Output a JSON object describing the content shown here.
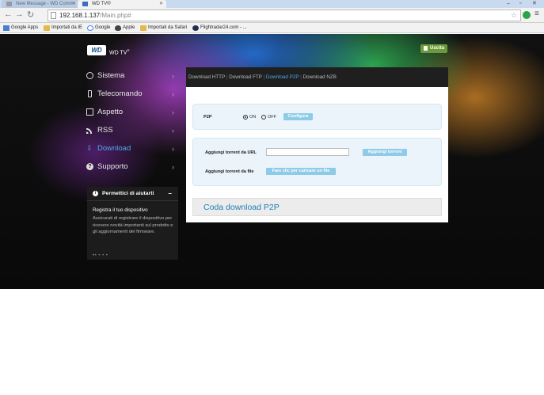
{
  "browser": {
    "tabs": [
      {
        "title": "New Message - WD Comm",
        "active": false
      },
      {
        "title": "WD TV®",
        "active": true
      }
    ],
    "url_host": "192.168.1.137",
    "url_path": "/Main.php#",
    "bookmarks": [
      "Google Apps",
      "Importati da IE",
      "Google",
      "Apple",
      "Importati da Safari",
      "Flightradar24.com - ..."
    ]
  },
  "header": {
    "logo": "WD",
    "product": "WD TV",
    "logout": "Uscita"
  },
  "sidebar": {
    "items": [
      {
        "label": "Sistema",
        "icon": "gear-icon",
        "active": false
      },
      {
        "label": "Telecomando",
        "icon": "remote-icon",
        "active": false
      },
      {
        "label": "Aspetto",
        "icon": "picture-icon",
        "active": false
      },
      {
        "label": "RSS",
        "icon": "rss-icon",
        "active": false
      },
      {
        "label": "Download",
        "icon": "download-icon",
        "active": true
      },
      {
        "label": "Supporto",
        "icon": "help-icon",
        "active": false
      }
    ]
  },
  "help": {
    "title": "Permettici di aiutarti",
    "subtitle": "Registra il tuo dispositivo",
    "text": "Assicurati di registrare il dispositivo per ricevere novità importanti sul prodotto e gli aggiornamenti del firmware."
  },
  "panel": {
    "tabs": [
      "Download HTTP",
      "Download FTP",
      "Download P2P",
      "Download NZB"
    ],
    "selected_tab": "Download P2P",
    "p2p": {
      "label": "P2P",
      "on_label": "ON",
      "off_label": "OFF",
      "state": "ON",
      "config_button": "Configura"
    },
    "torrent": {
      "url_label": "Aggiungi torrent da URL",
      "url_value": "",
      "add_button": "Aggiungi torrent",
      "file_label": "Aggiungi torrent da file",
      "file_button": "Fare clic per caricare un file"
    },
    "queue_title": "Coda download P2P"
  },
  "colors": {
    "accent": "#4ea8e6",
    "button": "#8ecbe8",
    "logout": "#6c9a3a"
  }
}
